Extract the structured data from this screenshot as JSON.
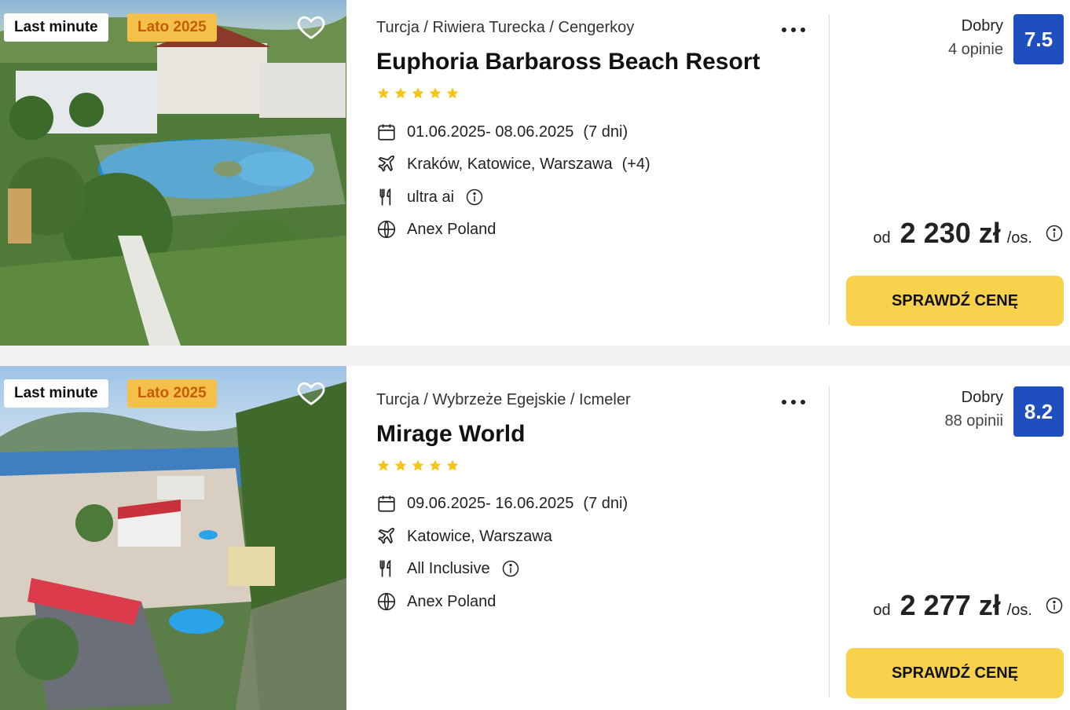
{
  "offers": [
    {
      "badges": {
        "last_minute": "Last minute",
        "season": "Lato 2025"
      },
      "breadcrumb": "Turcja / Riwiera Turecka / Cengerkoy",
      "hotel_name": "Euphoria Barbaross Beach Resort",
      "stars": 5,
      "dates": "01.06.2025- 08.06.2025",
      "duration": "(7 dni)",
      "departures": "Kraków, Katowice, Warszawa",
      "departures_more": "(+4)",
      "board": "ultra ai",
      "operator": "Anex Poland",
      "rating_label": "Dobry",
      "reviews": "4 opinie",
      "score": "7.5",
      "price_prefix": "od",
      "price": "2 230 zł",
      "price_unit": "/os.",
      "cta": "SPRAWDŹ CENĘ"
    },
    {
      "badges": {
        "last_minute": "Last minute",
        "season": "Lato 2025"
      },
      "breadcrumb": "Turcja / Wybrzeże Egejskie / Icmeler",
      "hotel_name": "Mirage World",
      "stars": 5,
      "dates": "09.06.2025- 16.06.2025",
      "duration": "(7 dni)",
      "departures": "Katowice, Warszawa",
      "departures_more": "",
      "board": "All Inclusive",
      "operator": "Anex Poland",
      "rating_label": "Dobry",
      "reviews": "88 opinii",
      "score": "8.2",
      "price_prefix": "od",
      "price": "2 277 zł",
      "price_unit": "/os.",
      "cta": "SPRAWDŹ CENĘ"
    }
  ],
  "icons": {
    "favorite": "heart-outline-icon",
    "more": "more-dots-icon",
    "star": "star-icon",
    "calendar": "calendar-icon",
    "departure": "plane-icon",
    "board": "cutlery-icon",
    "operator": "globe-icon",
    "info": "info-circle-icon"
  },
  "colors": {
    "score_bg": "#1f4fbf",
    "cta_bg": "#f8d24c",
    "season_badge_bg": "#f5c04a",
    "season_badge_text": "#c55d00",
    "star": "#f5c518"
  }
}
